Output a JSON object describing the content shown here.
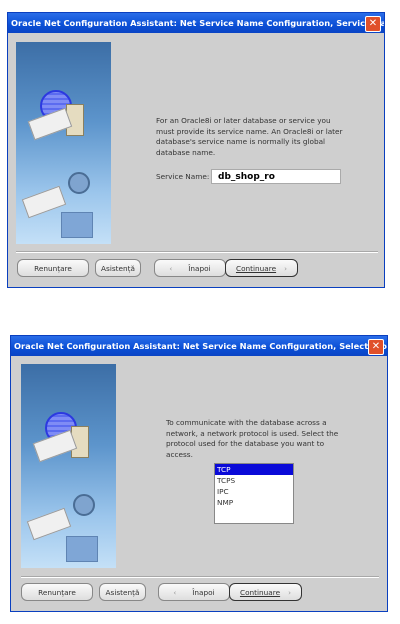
{
  "dialog1": {
    "title": "Oracle Net Configuration Assistant: Net Service Name Configuration, Service Name",
    "description": "For an Oracle8i or later database or service you must provide its service name. An Oracle8i or later database's service name is normally its global database name.",
    "service_name_label": "Service Name:",
    "service_name_value": "db_shop_ro",
    "buttons": {
      "cancel": "Renunțare",
      "help": "Asistență",
      "back": "Înapoi",
      "next": "Continuare"
    }
  },
  "dialog2": {
    "title": "Oracle Net Configuration Assistant: Net Service Name Configuration, Select Protocols",
    "description": "To communicate with the database across a network, a network protocol is used. Select the protocol used for the database you want to access.",
    "protocols": [
      "TCP",
      "TCPS",
      "IPC",
      "NMP"
    ],
    "selected_protocol": "TCP",
    "buttons": {
      "cancel": "Renunțare",
      "help": "Asistență",
      "back": "Înapoi",
      "next": "Continuare"
    }
  },
  "icons": {
    "back": "‹",
    "next": "›",
    "close": "✕"
  }
}
